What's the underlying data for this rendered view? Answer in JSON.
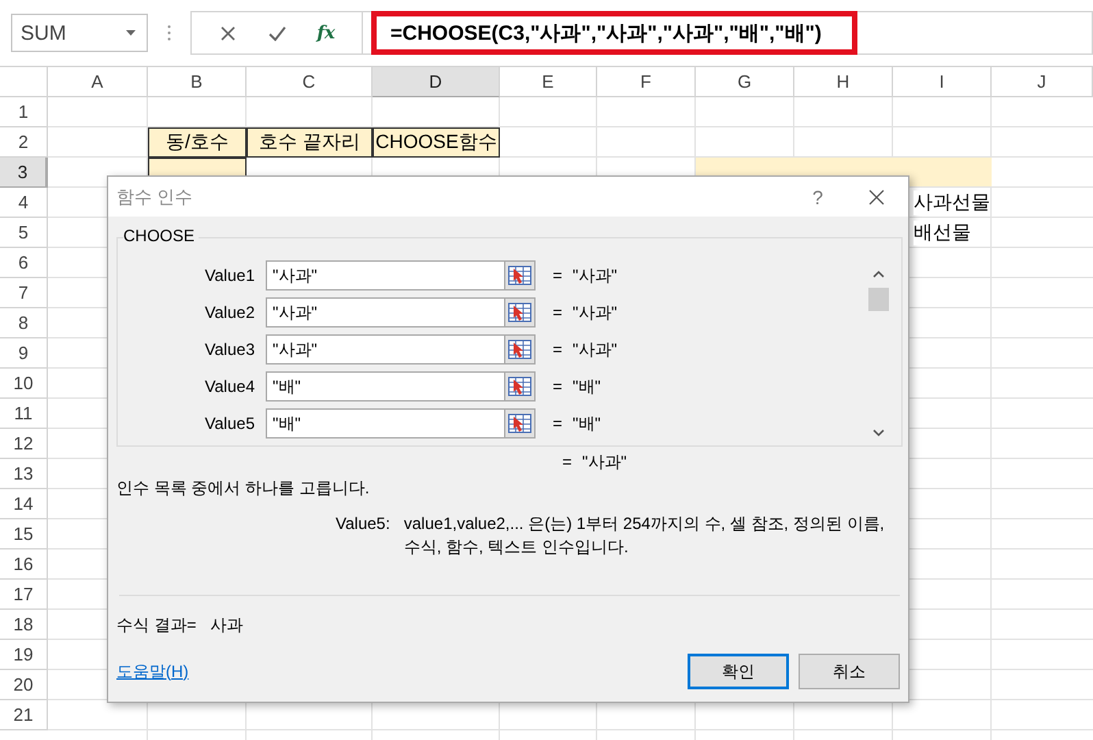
{
  "formula_bar": {
    "name_box": "SUM",
    "function_label": "fx",
    "formula": "=CHOOSE(C3,\"사과\",\"사과\",\"사과\",\"배\",\"배\")"
  },
  "sheet": {
    "columns": [
      {
        "label": "A",
        "selected": false
      },
      {
        "label": "B",
        "selected": false
      },
      {
        "label": "C",
        "selected": false
      },
      {
        "label": "D",
        "selected": true
      },
      {
        "label": "E",
        "selected": false
      },
      {
        "label": "F",
        "selected": false
      },
      {
        "label": "G",
        "selected": false
      },
      {
        "label": "H",
        "selected": false
      },
      {
        "label": "I",
        "selected": false
      },
      {
        "label": "J",
        "selected": false
      }
    ],
    "rows": [
      {
        "label": "1",
        "selected": false
      },
      {
        "label": "2",
        "selected": false,
        "cells": {
          "B": {
            "text": "동/호수",
            "highlighted": true,
            "bordered": true
          },
          "C": {
            "text": "호수 끝자리",
            "highlighted": true,
            "bordered": true
          },
          "D": {
            "text": "CHOOSE함수",
            "highlighted": true,
            "bordered": true
          }
        }
      },
      {
        "label": "3",
        "selected": true,
        "cells": {
          "B": {
            "highlighted": true,
            "bordered": true
          },
          "G": {
            "highlighted": true,
            "bordered": false
          },
          "H": {
            "highlighted": true,
            "bordered": false
          },
          "I": {
            "highlighted": true,
            "bordered": false
          }
        }
      },
      {
        "label": "4",
        "selected": false,
        "cells": {
          "I": {
            "text": "사과선물",
            "highlighted": false
          }
        }
      },
      {
        "label": "5",
        "selected": false,
        "cells": {
          "I": {
            "text": "배선물",
            "highlighted": false
          }
        }
      },
      {
        "label": "6",
        "selected": false
      },
      {
        "label": "7",
        "selected": false
      },
      {
        "label": "8",
        "selected": false
      },
      {
        "label": "9",
        "selected": false
      },
      {
        "label": "10",
        "selected": false
      },
      {
        "label": "11",
        "selected": false
      },
      {
        "label": "12",
        "selected": false
      },
      {
        "label": "13",
        "selected": false
      },
      {
        "label": "14",
        "selected": false
      },
      {
        "label": "15",
        "selected": false
      },
      {
        "label": "16",
        "selected": false
      },
      {
        "label": "17",
        "selected": false
      },
      {
        "label": "18",
        "selected": false
      },
      {
        "label": "19",
        "selected": false
      },
      {
        "label": "20",
        "selected": false
      },
      {
        "label": "21",
        "selected": false
      }
    ]
  },
  "dialog": {
    "title": "함수 인수",
    "help_glyph": "?",
    "function_name": "CHOOSE",
    "arguments": [
      {
        "label": "Value1",
        "value": "\"사과\"",
        "equals": "=",
        "result": "\"사과\""
      },
      {
        "label": "Value2",
        "value": "\"사과\"",
        "equals": "=",
        "result": "\"사과\""
      },
      {
        "label": "Value3",
        "value": "\"사과\"",
        "equals": "=",
        "result": "\"사과\""
      },
      {
        "label": "Value4",
        "value": "\"배\"",
        "equals": "=",
        "result": "\"배\""
      },
      {
        "label": "Value5",
        "value": "\"배\"",
        "equals": "=",
        "result": "\"배\""
      }
    ],
    "total": {
      "equals": "=",
      "value": "\"사과\""
    },
    "description": "인수 목록 중에서 하나를 고릅니다.",
    "argument_help": {
      "label": "Value5:",
      "text": "value1,value2,... 은(는) 1부터 254까지의 수, 셀 참조, 정의된 이름, 수식, 함수, 텍스트 인수입니다."
    },
    "formula_result": {
      "label": "수식 결과=",
      "value": "사과"
    },
    "help_link": "도움말(H)",
    "buttons": [
      {
        "label": "확인",
        "default": true
      },
      {
        "label": "취소",
        "default": false
      }
    ]
  }
}
